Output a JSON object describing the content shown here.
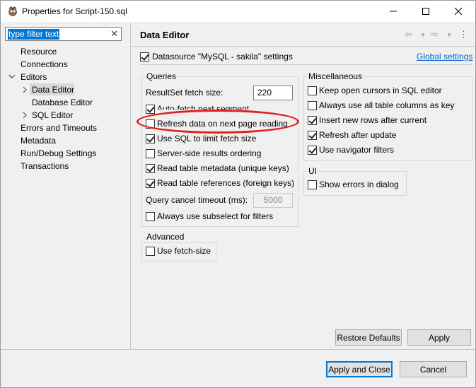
{
  "window": {
    "title": "Properties for Script-150.sql"
  },
  "filter": {
    "value": "type filter text"
  },
  "tree": {
    "items": [
      {
        "label": "Resource"
      },
      {
        "label": "Connections"
      },
      {
        "label": "Editors"
      },
      {
        "label": "Data Editor"
      },
      {
        "label": "Database Editor"
      },
      {
        "label": "SQL Editor"
      },
      {
        "label": "Errors and Timeouts"
      },
      {
        "label": "Metadata"
      },
      {
        "label": "Run/Debug Settings"
      },
      {
        "label": "Transactions"
      }
    ],
    "selected": "Data Editor"
  },
  "page": {
    "title": "Data Editor",
    "datasource_label": "Datasource \"MySQL - sakila\" settings",
    "datasource_checked": true,
    "global_settings_link": "Global settings"
  },
  "queries": {
    "title": "Queries",
    "fetch_size_label": "ResultSet fetch size:",
    "fetch_size_value": "220",
    "options": [
      {
        "label": "Auto-fetch next segment",
        "checked": true
      },
      {
        "label": "Refresh data on next page reading",
        "checked": false
      },
      {
        "label": "Use SQL to limit fetch size",
        "checked": true
      },
      {
        "label": "Server-side results ordering",
        "checked": false
      },
      {
        "label": "Read table metadata (unique keys)",
        "checked": true
      },
      {
        "label": "Read table references (foreign keys)",
        "checked": true
      }
    ],
    "cancel_timeout_label": "Query cancel timeout (ms):",
    "cancel_timeout_value": "5000",
    "subselect_label": "Always use subselect for filters",
    "subselect_checked": false
  },
  "misc": {
    "title": "Miscellaneous",
    "options": [
      {
        "label": "Keep open cursors in SQL editor",
        "checked": false
      },
      {
        "label": "Always use all table columns as key",
        "checked": false
      },
      {
        "label": "Insert new rows after current",
        "checked": true
      },
      {
        "label": "Refresh after update",
        "checked": true
      },
      {
        "label": "Use navigator filters",
        "checked": true
      }
    ]
  },
  "ui": {
    "title": "UI",
    "show_errors_label": "Show errors in dialog",
    "show_errors_checked": false
  },
  "advanced": {
    "title": "Advanced",
    "fetch_size_label": "Use fetch-size",
    "fetch_size_checked": false
  },
  "buttons": {
    "restore_defaults": "Restore Defaults",
    "apply": "Apply",
    "apply_and_close": "Apply and Close",
    "cancel": "Cancel"
  },
  "colors": {
    "accent": "#0078d7",
    "link": "#0066cc",
    "annotation": "#e02020"
  }
}
